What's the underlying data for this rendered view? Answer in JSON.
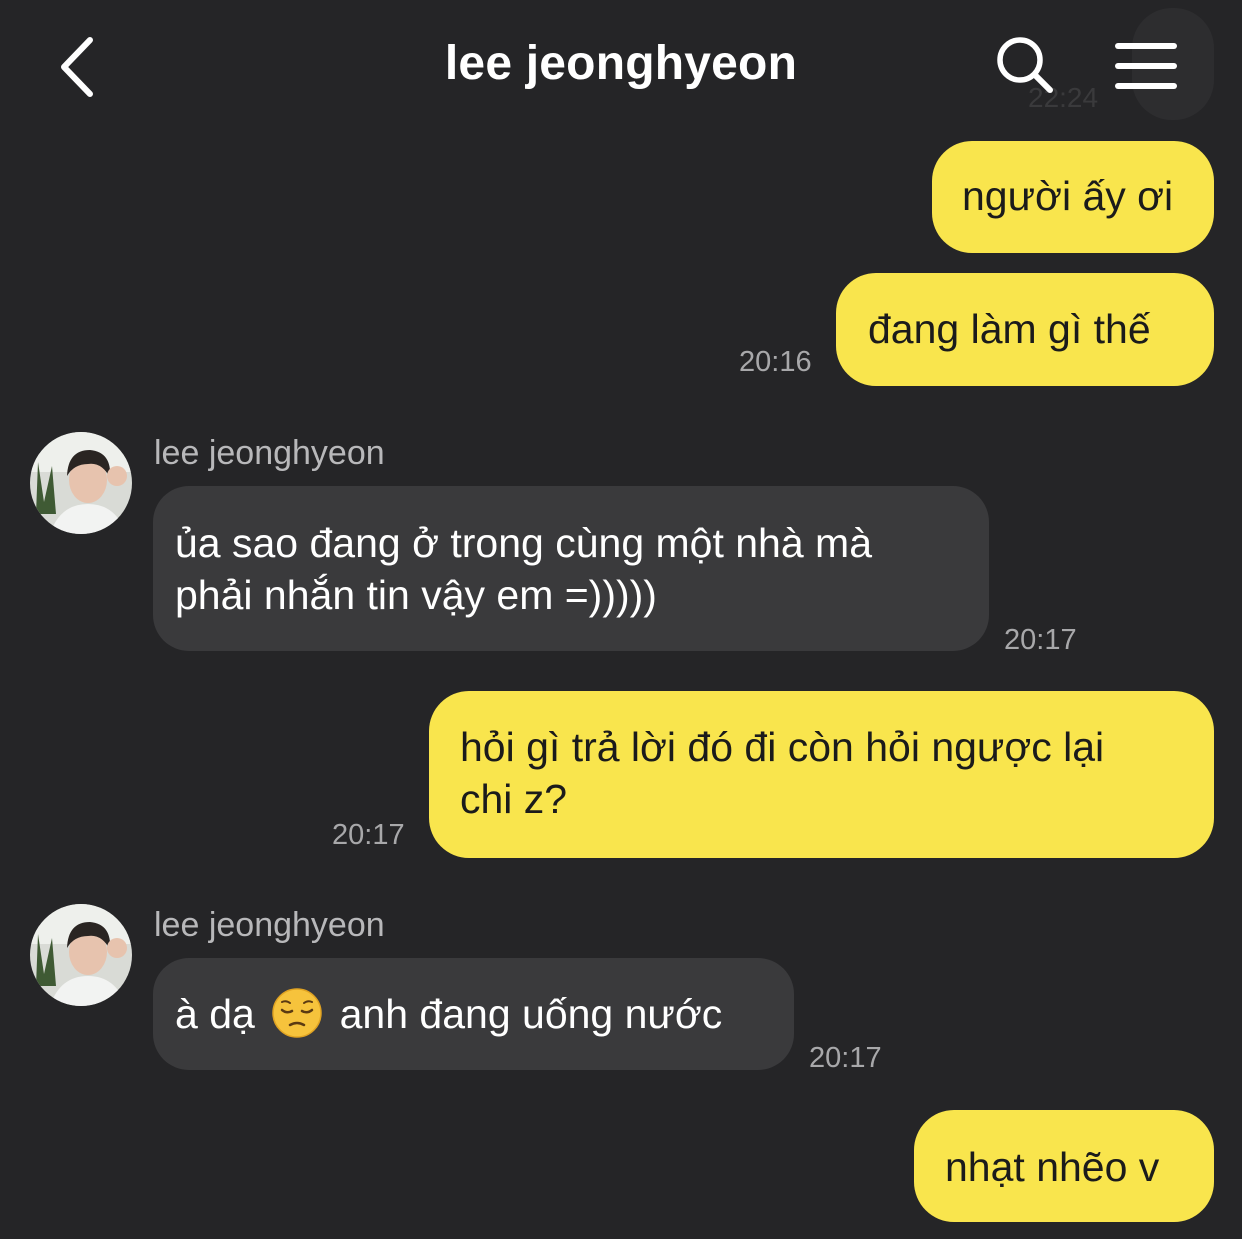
{
  "header": {
    "title": "lee jeonghyeon"
  },
  "ghost": {
    "time": "22:24"
  },
  "messages": [
    {
      "from": "me",
      "text": "người ấy ơi",
      "time": ""
    },
    {
      "from": "me",
      "text": "đang làm gì thế",
      "time": "20:16"
    },
    {
      "from": "other",
      "sender": "lee jeonghyeon",
      "line1": "ủa sao đang ở trong cùng một nhà mà",
      "line2": "phải nhắn tin vậy em =)))))",
      "time": "20:17"
    },
    {
      "from": "me",
      "line1": "hỏi gì trả lời đó đi còn hỏi ngược lại",
      "line2": "chi z?",
      "time": "20:17"
    },
    {
      "from": "other",
      "sender": "lee jeonghyeon",
      "before_emoji": "à dạ",
      "emoji": "pensive-face",
      "after_emoji": "anh đang uống nước",
      "time": "20:17"
    },
    {
      "from": "me",
      "text": "nhạt nhẽo v",
      "time": ""
    }
  ],
  "icons": {
    "back": "chevron-left-icon",
    "search": "search-icon",
    "menu": "hamburger-menu-icon"
  },
  "colors": {
    "background": "#252527",
    "my_bubble": "#f9e54d",
    "other_bubble": "#3a3a3c",
    "timestamp": "#a8a8aa"
  }
}
